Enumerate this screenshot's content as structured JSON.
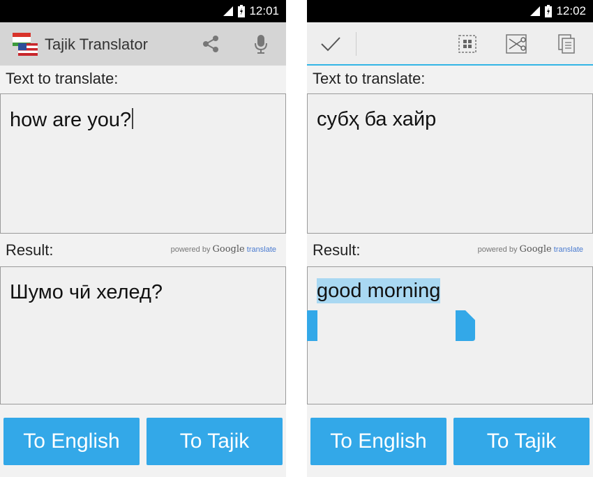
{
  "left": {
    "status": {
      "time": "12:01"
    },
    "app_title": "Tajik Translator",
    "input_label": "Text to translate:",
    "input_value": "how are you?",
    "result_label": "Result:",
    "powered_prefix": "powered by",
    "powered_brand": "Google",
    "powered_suffix": "translate",
    "result_value": "Шумо чӣ хелед?",
    "buttons": {
      "to_english": "To English",
      "to_tajik": "To Tajik"
    }
  },
  "right": {
    "status": {
      "time": "12:02"
    },
    "input_label": "Text to translate:",
    "input_value": "субҳ ба хайр",
    "result_label": "Result:",
    "powered_prefix": "powered by",
    "powered_brand": "Google",
    "powered_suffix": "translate",
    "result_value": "good morning",
    "buttons": {
      "to_english": "To English",
      "to_tajik": "To Tajik"
    }
  },
  "icons": [
    "signal-icon",
    "battery-icon",
    "flags-icon",
    "share-icon",
    "microphone-icon",
    "done-check-icon",
    "select-all-icon",
    "cut-icon",
    "copy-icon"
  ],
  "colors": {
    "button": "#33a8e8",
    "selection": "#a9d8f2",
    "accent": "#33b5e5"
  }
}
